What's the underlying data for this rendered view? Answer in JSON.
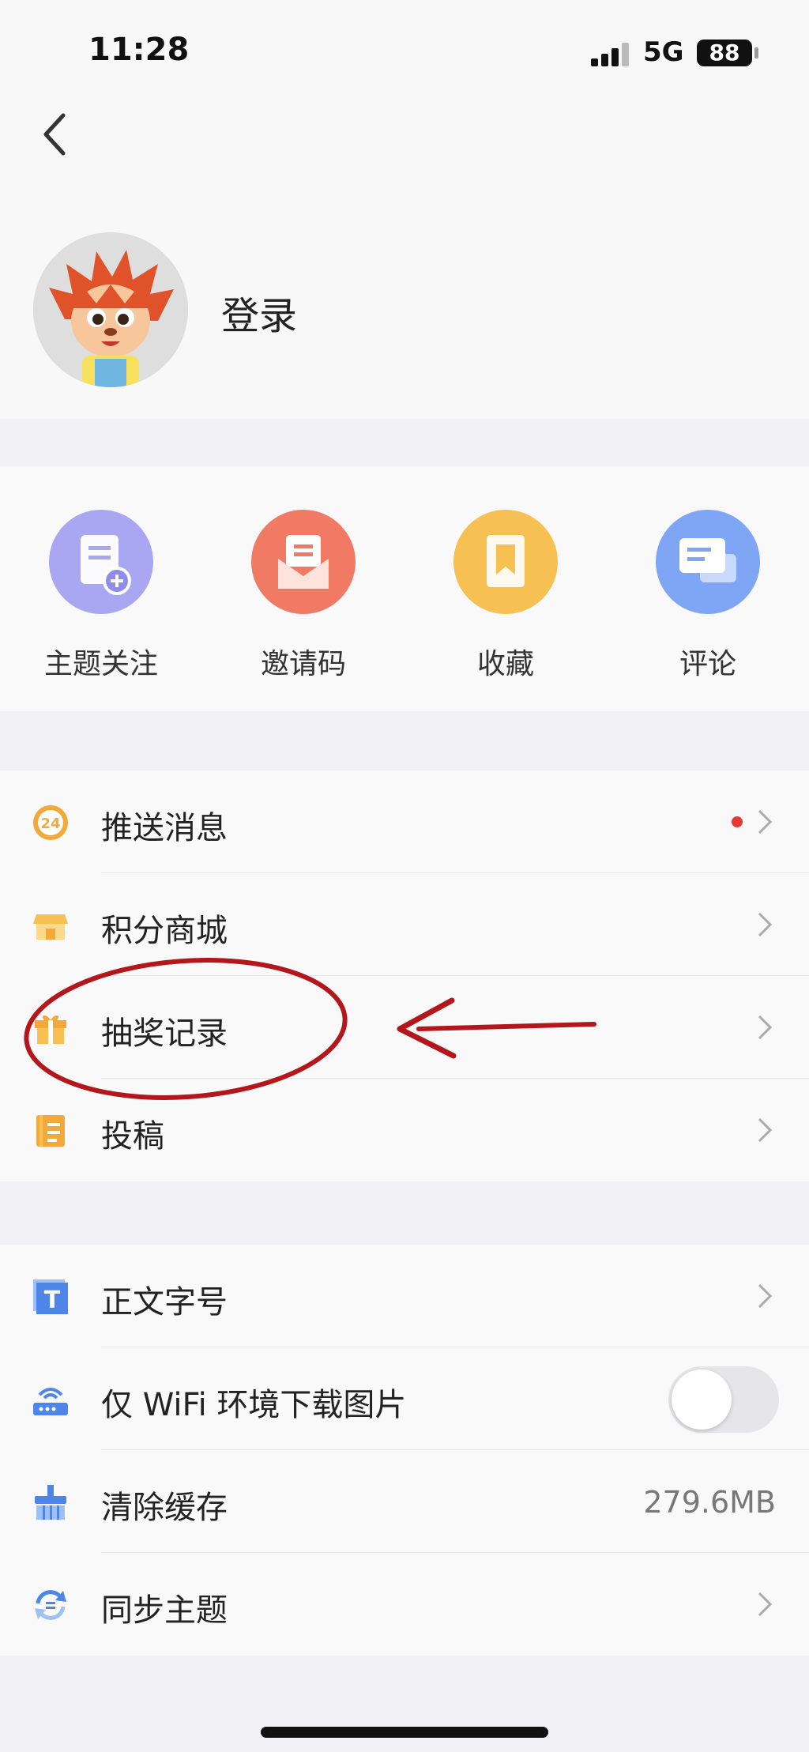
{
  "status_bar": {
    "time": "11:28",
    "network": "5G",
    "battery": "88"
  },
  "header": {
    "login_label": "登录"
  },
  "quick_actions": [
    {
      "label": "主题关注",
      "icon": "topic-follow-icon",
      "color": "#a9a6f2"
    },
    {
      "label": "邀请码",
      "icon": "invite-envelope-icon",
      "color": "#f07a63"
    },
    {
      "label": "收藏",
      "icon": "bookmark-icon",
      "color": "#f6c052"
    },
    {
      "label": "评论",
      "icon": "comment-bubbles-icon",
      "color": "#7ea6f4"
    }
  ],
  "menu_group_1": [
    {
      "label": "推送消息",
      "icon": "clock-24-icon",
      "has_badge": true
    },
    {
      "label": "积分商城",
      "icon": "shop-icon"
    },
    {
      "label": "抽奖记录",
      "icon": "gift-icon"
    },
    {
      "label": "投稿",
      "icon": "notebook-icon"
    }
  ],
  "menu_group_2": [
    {
      "label": "正文字号",
      "icon": "font-size-icon"
    },
    {
      "label": "仅 WiFi 环境下载图片",
      "icon": "router-icon",
      "toggle_on": false
    },
    {
      "label": "清除缓存",
      "icon": "broom-icon",
      "value": "279.6MB"
    },
    {
      "label": "同步主题",
      "icon": "sync-icon"
    }
  ],
  "colors": {
    "annotation": "#b3171b",
    "badge": "#e53935",
    "icon_blue": "#4d86e8",
    "icon_orange": "#f3a93a"
  }
}
